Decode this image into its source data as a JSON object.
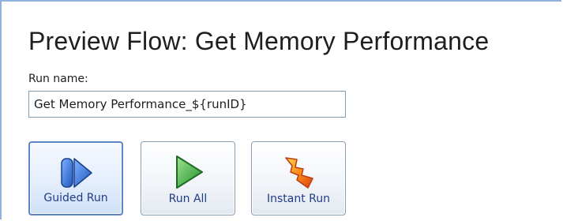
{
  "header": {
    "title": "Preview Flow: Get Memory Performance"
  },
  "run_name": {
    "label": "Run name:",
    "value": "Get Memory Performance_${runID}"
  },
  "buttons": [
    {
      "label": "Guided Run",
      "icon": "guided-run-icon",
      "active": true
    },
    {
      "label": "Run All",
      "icon": "play-icon",
      "active": false
    },
    {
      "label": "Instant Run",
      "icon": "lightning-icon",
      "active": false
    }
  ],
  "colors": {
    "accent_border": "#5a86c4",
    "label_text": "#1f3c88",
    "guided_icon_blue": "#2f6fd1",
    "play_icon_green": "#37b33a",
    "lightning_orange": "#f07a12"
  }
}
